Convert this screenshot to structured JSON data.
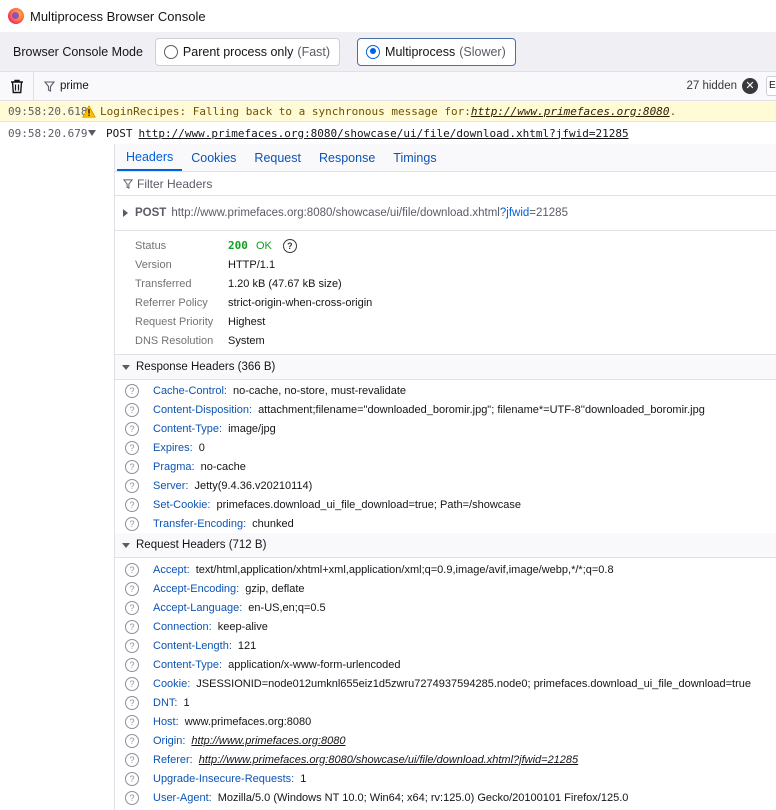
{
  "window": {
    "title": "Multiprocess Browser Console"
  },
  "mode_bar": {
    "label": "Browser Console Mode",
    "options": [
      {
        "label": "Parent process only",
        "hint": "(Fast)",
        "selected": false
      },
      {
        "label": "Multiprocess",
        "hint": "(Slower)",
        "selected": true
      }
    ]
  },
  "filter_bar": {
    "filter_value": "prime",
    "hidden_count": "27 hidden",
    "overflow_label": "E"
  },
  "log": {
    "warning": {
      "timestamp": "09:58:20.618",
      "message": "LoginRecipes: Falling back to a synchronous message for: ",
      "link": "http://www.primefaces.org:8080",
      "suffix": "."
    },
    "request": {
      "timestamp": "09:58:20.679",
      "method": "POST",
      "url": "http://www.primefaces.org:8080/showcase/ui/file/download.xhtml?jfwid=21285"
    }
  },
  "details": {
    "tabs": [
      "Headers",
      "Cookies",
      "Request",
      "Response",
      "Timings"
    ],
    "active_tab": "Headers",
    "filter_placeholder": "Filter Headers",
    "summary": {
      "method": "POST",
      "host_path": "http://www.primefaces.org:8080/showcase/ui/file/download.xhtml",
      "query_key": "?jfwid",
      "query_eq": "=21285"
    },
    "status": {
      "status_label": "Status",
      "status_code": "200",
      "status_text": "OK",
      "version_label": "Version",
      "version": "HTTP/1.1",
      "transferred_label": "Transferred",
      "transferred": "1.20 kB (47.67 kB size)",
      "referrer_label": "Referrer Policy",
      "referrer": "strict-origin-when-cross-origin",
      "priority_label": "Request Priority",
      "priority": "Highest",
      "dns_label": "DNS Resolution",
      "dns": "System"
    },
    "response_headers": {
      "title": "Response Headers (366 B)",
      "items": [
        {
          "name": "Cache-Control:",
          "value": "no-cache, no-store, must-revalidate"
        },
        {
          "name": "Content-Disposition:",
          "value": "attachment;filename=\"downloaded_boromir.jpg\"; filename*=UTF-8''downloaded_boromir.jpg"
        },
        {
          "name": "Content-Type:",
          "value": "image/jpg"
        },
        {
          "name": "Expires:",
          "value": "0"
        },
        {
          "name": "Pragma:",
          "value": "no-cache"
        },
        {
          "name": "Server:",
          "value": "Jetty(9.4.36.v20210114)"
        },
        {
          "name": "Set-Cookie:",
          "value": "primefaces.download_ui_file_download=true; Path=/showcase"
        },
        {
          "name": "Transfer-Encoding:",
          "value": "chunked"
        }
      ]
    },
    "request_headers": {
      "title": "Request Headers (712 B)",
      "items": [
        {
          "name": "Accept:",
          "value": "text/html,application/xhtml+xml,application/xml;q=0.9,image/avif,image/webp,*/*;q=0.8"
        },
        {
          "name": "Accept-Encoding:",
          "value": "gzip, deflate"
        },
        {
          "name": "Accept-Language:",
          "value": "en-US,en;q=0.5"
        },
        {
          "name": "Connection:",
          "value": "keep-alive"
        },
        {
          "name": "Content-Length:",
          "value": "121"
        },
        {
          "name": "Content-Type:",
          "value": "application/x-www-form-urlencoded"
        },
        {
          "name": "Cookie:",
          "value": "JSESSIONID=node012umknl655eiz1d5zwru7274937594285.node0; primefaces.download_ui_file_download=true"
        },
        {
          "name": "DNT:",
          "value": "1"
        },
        {
          "name": "Host:",
          "value": "www.primefaces.org:8080"
        },
        {
          "name": "Origin:",
          "value": "http://www.primefaces.org:8080",
          "link": true
        },
        {
          "name": "Referer:",
          "value": "http://www.primefaces.org:8080/showcase/ui/file/download.xhtml?jfwid=21285",
          "link": true
        },
        {
          "name": "Upgrade-Insecure-Requests:",
          "value": "1"
        },
        {
          "name": "User-Agent:",
          "value": "Mozilla/5.0 (Windows NT 10.0; Win64; x64; rv:125.0) Gecko/20100101 Firefox/125.0"
        }
      ]
    }
  }
}
